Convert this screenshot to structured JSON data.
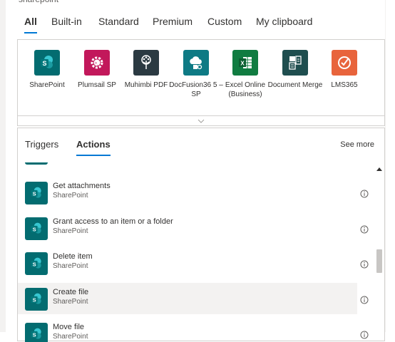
{
  "search": {
    "value": "sharepoint"
  },
  "filter_tabs": [
    "All",
    "Built-in",
    "Standard",
    "Premium",
    "Custom",
    "My clipboard"
  ],
  "active_filter": "All",
  "connectors": [
    {
      "name": "SharePoint",
      "color": "#036c70",
      "icon": "sharepoint-icon"
    },
    {
      "name": "Plumsail SP",
      "color": "#c2185b",
      "icon": "plumsail-gear-icon"
    },
    {
      "name": "Muhimbi PDF",
      "color": "#2b3a42",
      "icon": "muhimbi-tree-icon"
    },
    {
      "name": "DocFusion36 5 – SP",
      "color": "#0e7a84",
      "icon": "docfusion-cloud-icon"
    },
    {
      "name": "Excel Online (Business)",
      "color": "#107c41",
      "icon": "excel-icon"
    },
    {
      "name": "Document Merge",
      "color": "#1f4e4f",
      "icon": "document-merge-icon"
    },
    {
      "name": "LMS365",
      "color": "#e8643c",
      "icon": "lms365-check-icon"
    }
  ],
  "tabs": {
    "triggers": "Triggers",
    "actions": "Actions",
    "active": "Actions",
    "see_more": "See more"
  },
  "actions": [
    {
      "title": "Get attachments",
      "subtitle": "SharePoint"
    },
    {
      "title": "Grant access to an item or a folder",
      "subtitle": "SharePoint"
    },
    {
      "title": "Delete item",
      "subtitle": "SharePoint"
    },
    {
      "title": "Create file",
      "subtitle": "SharePoint",
      "highlighted": true
    },
    {
      "title": "Move file",
      "subtitle": "SharePoint"
    }
  ],
  "colors": {
    "accent": "#0078d4",
    "sharepoint": "#036c70"
  }
}
